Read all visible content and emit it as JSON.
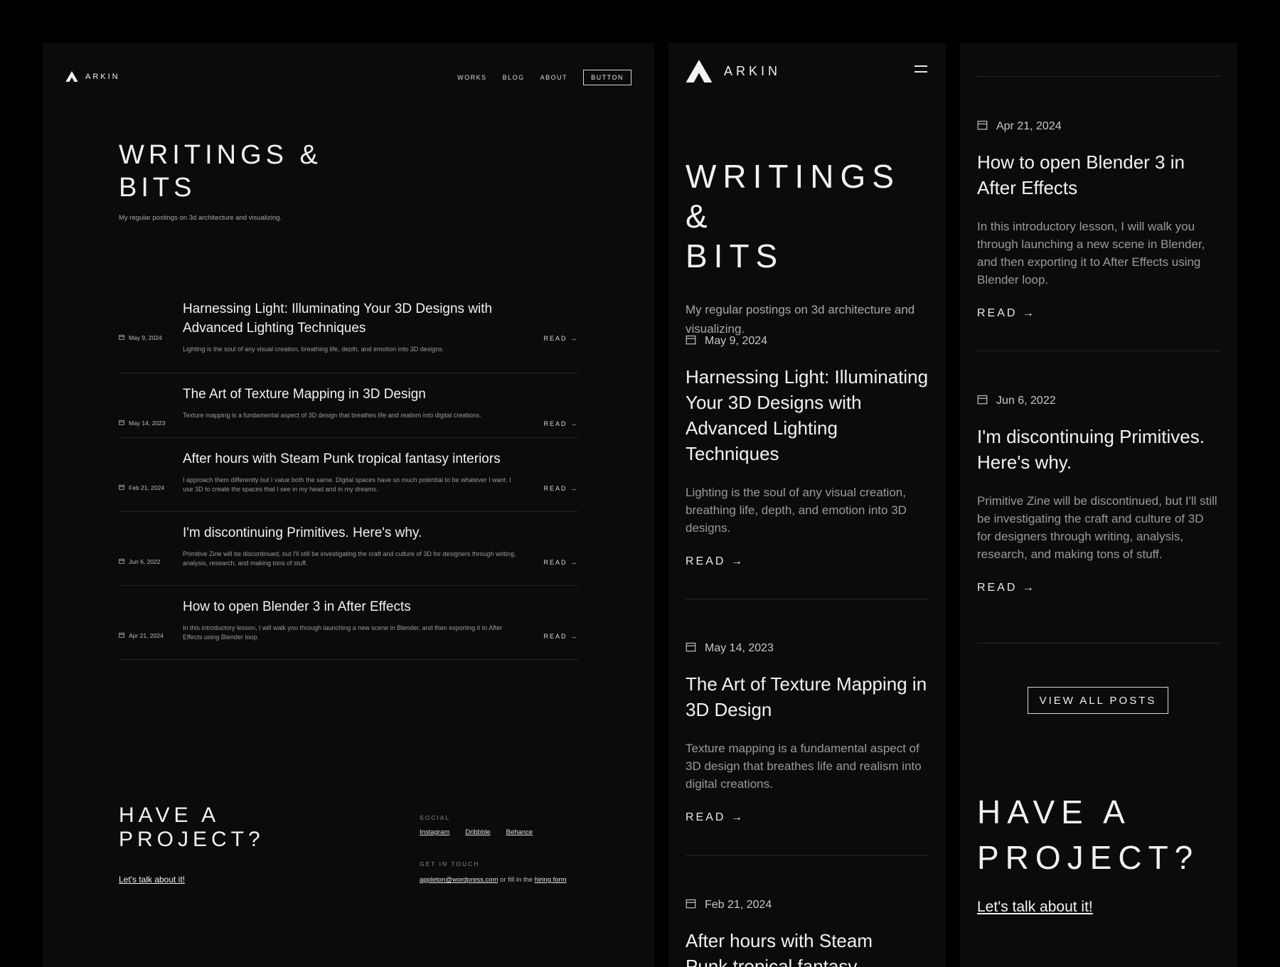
{
  "brand": {
    "name": "ARKIN"
  },
  "nav": {
    "items": [
      "WORKS",
      "BLOG",
      "ABOUT"
    ],
    "button": "BUTTON"
  },
  "hero": {
    "title_line1": "WRITINGS &",
    "title_line2": "BITS",
    "subtitle": "My regular postings on 3d architecture and visualizing."
  },
  "read_label": "READ",
  "posts": [
    {
      "date": "May 9, 2024",
      "title": "Harnessing Light: Illuminating Your 3D Designs with Advanced Lighting Techniques",
      "excerpt": "Lighting is the soul of any visual creation, breathing life, depth, and emotion into 3D designs."
    },
    {
      "date": "May 14, 2023",
      "title": "The Art of Texture Mapping in 3D Design",
      "excerpt": "Texture mapping is a fundamental aspect of 3D design that breathes life and realism into digital creations."
    },
    {
      "date": "Feb 21, 2024",
      "title": "After hours with Steam Punk tropical fantasy interiors",
      "excerpt": "I approach them differently but I value both the same. Digital spaces have so much potential to be whatever I want. I use 3D to create the spaces that I see in my head and in my dreams."
    },
    {
      "date": "Jun 6, 2022",
      "title": "I'm discontinuing Primitives. Here's why.",
      "excerpt": "Primitive Zine will be discontinued, but I'll still be investigating the craft and culture of 3D for designers through writing, analysis, research, and making tons of stuff."
    },
    {
      "date": "Apr 21, 2024",
      "title": "How to open Blender 3 in After Effects",
      "excerpt": "In this introductory lesson, I will walk you through launching a new scene in Blender, and then exporting it to After Effects using Blender loop."
    }
  ],
  "footer": {
    "title_line1": "HAVE A",
    "title_line2": "PROJECT?",
    "cta": "Let's talk about it!",
    "social_heading": "SOCIAL",
    "social_links": [
      "Instagram",
      "Dribbble",
      "Behance"
    ],
    "touch_heading": "GET IN TOUCH",
    "email": "appleton@wordpress.com",
    "touch_middle": "or fill in the",
    "form_link": "hiring form"
  },
  "view_all": "VIEW ALL POSTS",
  "tablet_partial": {
    "title_line1": "After hours with Steam",
    "title_line2": "Punk tropical fantasy"
  }
}
